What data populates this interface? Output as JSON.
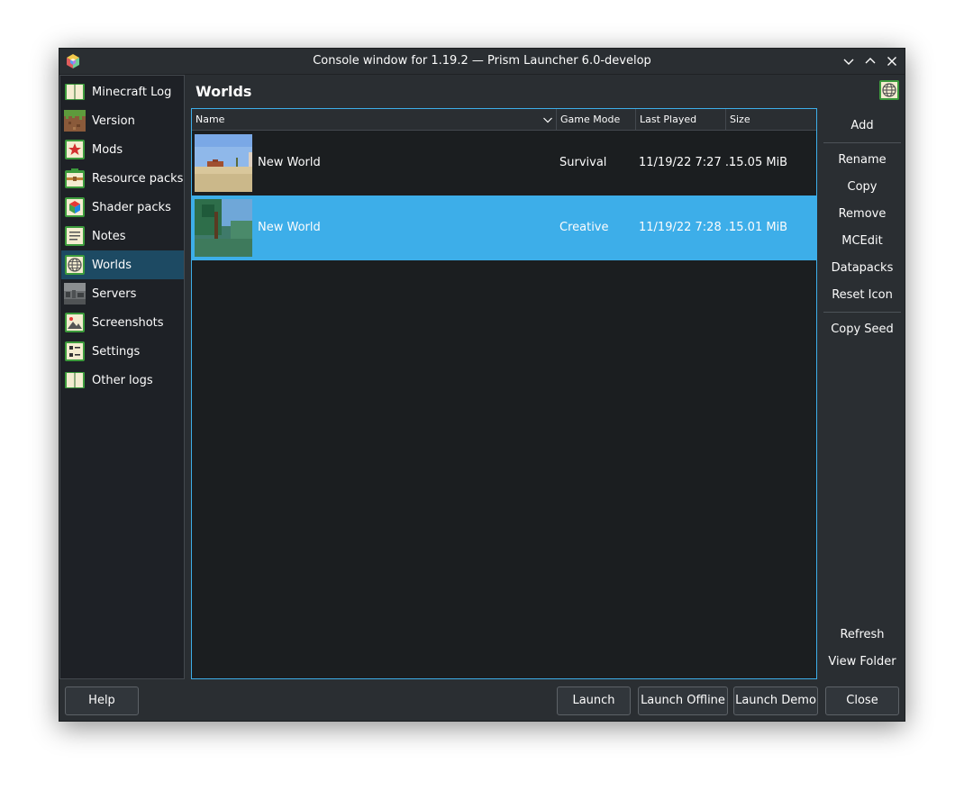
{
  "window": {
    "title": "Console window for 1.19.2 — Prism Launcher 6.0-develop"
  },
  "sidebar": {
    "items": [
      {
        "label": "Minecraft Log",
        "icon": "log-book-icon"
      },
      {
        "label": "Version",
        "icon": "grass-block-icon"
      },
      {
        "label": "Mods",
        "icon": "mods-star-icon"
      },
      {
        "label": "Resource packs",
        "icon": "resource-pack-icon"
      },
      {
        "label": "Shader packs",
        "icon": "shader-pack-icon"
      },
      {
        "label": "Notes",
        "icon": "notes-icon"
      },
      {
        "label": "Worlds",
        "icon": "worlds-globe-icon",
        "active": true
      },
      {
        "label": "Servers",
        "icon": "servers-icon"
      },
      {
        "label": "Screenshots",
        "icon": "screenshots-icon"
      },
      {
        "label": "Settings",
        "icon": "settings-icon"
      },
      {
        "label": "Other logs",
        "icon": "other-logs-book-icon"
      }
    ]
  },
  "page": {
    "title": "Worlds",
    "icon": "worlds-globe-icon"
  },
  "table": {
    "columns": [
      "Name",
      "Game Mode",
      "Last Played",
      "Size"
    ],
    "rows": [
      {
        "name": "New World",
        "game_mode": "Survival",
        "last_played": "11/19/22 7:27 ...",
        "size": "15.05 MiB",
        "selected": false
      },
      {
        "name": "New World",
        "game_mode": "Creative",
        "last_played": "11/19/22 7:28 ...",
        "size": "15.01 MiB",
        "selected": true
      }
    ]
  },
  "actions": {
    "add": "Add",
    "rename": "Rename",
    "copy": "Copy",
    "remove": "Remove",
    "mcedit": "MCEdit",
    "datapacks": "Datapacks",
    "reset_icon": "Reset Icon",
    "copy_seed": "Copy Seed",
    "refresh": "Refresh",
    "view_folder": "View Folder"
  },
  "footer": {
    "help": "Help",
    "launch": "Launch",
    "launch_offline": "Launch Offline",
    "launch_demo": "Launch Demo",
    "close": "Close"
  },
  "colors": {
    "accent": "#3daee9",
    "window_bg": "#2a2e32",
    "view_bg": "#1b1e20"
  }
}
